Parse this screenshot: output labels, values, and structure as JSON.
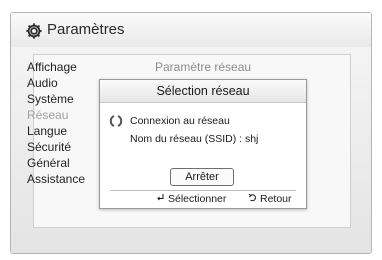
{
  "window": {
    "title": "Paramètres",
    "title_icon": "gear-icon"
  },
  "menu": {
    "items": [
      {
        "label": "Affichage",
        "dimmed": false
      },
      {
        "label": "Audio",
        "dimmed": false
      },
      {
        "label": "Système",
        "dimmed": false
      },
      {
        "label": "Réseau",
        "dimmed": true
      },
      {
        "label": "Langue",
        "dimmed": false
      },
      {
        "label": "Sécurité",
        "dimmed": false
      },
      {
        "label": "Général",
        "dimmed": false
      },
      {
        "label": "Assistance",
        "dimmed": false
      }
    ]
  },
  "submenu": {
    "header": "Paramètre réseau"
  },
  "dialog": {
    "title": "Sélection réseau",
    "status_line": "Connexion au réseau",
    "ssid_line": "Nom du réseau (SSID) : shj",
    "stop_label": "Arrêter",
    "hint_select": "Sélectionner",
    "hint_back": "Retour",
    "hint_select_icon": "enter-icon",
    "hint_back_icon": "return-icon"
  }
}
